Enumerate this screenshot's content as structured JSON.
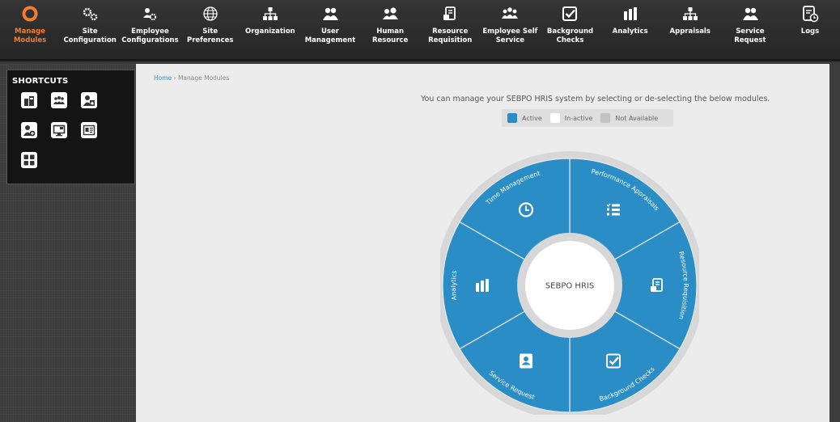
{
  "nav": {
    "items": [
      {
        "label": "Manage Modules",
        "icon": "circle-gear-icon",
        "active": true
      },
      {
        "label": "Site Configuration",
        "icon": "gears-icon"
      },
      {
        "label": "Employee Configurations",
        "icon": "employee-config-icon"
      },
      {
        "label": "Site Preferences",
        "icon": "globe-icon"
      },
      {
        "label": "Organization",
        "icon": "org-chart-icon"
      },
      {
        "label": "User Management",
        "icon": "users-icon"
      },
      {
        "label": "Human Resource",
        "icon": "people-icon"
      },
      {
        "label": "Resource Requisition",
        "icon": "document-icon"
      },
      {
        "label": "Employee Self Service",
        "icon": "group-icon"
      },
      {
        "label": "Background Checks",
        "icon": "checkbox-icon"
      },
      {
        "label": "Analytics",
        "icon": "bar-chart-icon"
      },
      {
        "label": "Appraisals",
        "icon": "org-chart-icon"
      },
      {
        "label": "Service Request",
        "icon": "users-icon"
      },
      {
        "label": "Logs",
        "icon": "log-icon"
      }
    ]
  },
  "shortcuts": {
    "title": "SHORTCUTS",
    "items": [
      "config-shortcut-icon",
      "users-shortcut-icon",
      "appraisal-shortcut-icon",
      "add-user-shortcut-icon",
      "monitor-shortcut-icon",
      "id-card-shortcut-icon",
      "grid-shortcut-icon"
    ]
  },
  "breadcrumb": {
    "home": "Home",
    "separator": "›",
    "current": "Manage Modules"
  },
  "intro": "You can manage your SEBPO HRIS system by selecting or de-selecting the below modules.",
  "legend": [
    {
      "label": "Active",
      "color": "#2a8dc5"
    },
    {
      "label": "In-active",
      "color": "#ffffff"
    },
    {
      "label": "Not Available",
      "color": "#c2c2c2"
    }
  ],
  "wheel": {
    "center_label": "SEBPO HRIS",
    "active_color": "#2a8dc5",
    "segments": [
      {
        "label": "Performance Appraisals",
        "icon": "list-icon"
      },
      {
        "label": "Resource Requisition",
        "icon": "document-icon"
      },
      {
        "label": "Background Checks",
        "icon": "checkbox-icon"
      },
      {
        "label": "Service Request",
        "icon": "person-card-icon"
      },
      {
        "label": "Analytics",
        "icon": "bar-chart-icon"
      },
      {
        "label": "Time Management",
        "icon": "clock-icon"
      }
    ]
  }
}
